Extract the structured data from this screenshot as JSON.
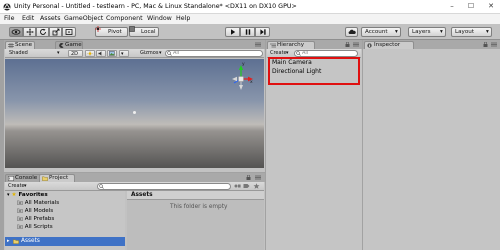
{
  "window": {
    "title": "Unity Personal - Untitled - testlearn - PC, Mac & Linux Standalone* <DX11 on DX10 GPU>",
    "min_glyph": "–",
    "max_glyph": "☐",
    "close_glyph": "✕"
  },
  "menu": {
    "items": [
      "File",
      "Edit",
      "Assets",
      "GameObject",
      "Component",
      "Window",
      "Help"
    ]
  },
  "toolbar": {
    "pivot_label": "Pivot",
    "local_label": "Local",
    "account_label": "Account",
    "layers_label": "Layers",
    "layout_label": "Layout",
    "dropdown_arrow": "▾"
  },
  "scene": {
    "tab_scene": "Scene",
    "tab_game": "Game",
    "shading_mode": "Shaded",
    "mode_2d": "2D",
    "gizmos_label": "Gizmos",
    "search_placeholder": "All",
    "gizmo_x_label": "x",
    "gizmo_y_label": "y"
  },
  "hierarchy": {
    "tab_label": "Hierarchy",
    "create_label": "Create",
    "search_placeholder": "All",
    "items": [
      "Main Camera",
      "Directional Light"
    ]
  },
  "inspector": {
    "tab_label": "Inspector"
  },
  "console": {
    "tab_label": "Console"
  },
  "project": {
    "tab_label": "Project",
    "create_label": "Create",
    "favorites_label": "Favorites",
    "favorites": [
      "All Materials",
      "All Models",
      "All Prefabs",
      "All Scripts"
    ],
    "assets_label": "Assets",
    "assets_header": "Assets",
    "empty_message": "This folder is empty"
  },
  "colors": {
    "highlight_box": "#e01010",
    "panel_bg": "#c2c2c2",
    "gizmo_x": "#e02020",
    "gizmo_y": "#22cc22",
    "gizmo_z": "#2060ff"
  }
}
